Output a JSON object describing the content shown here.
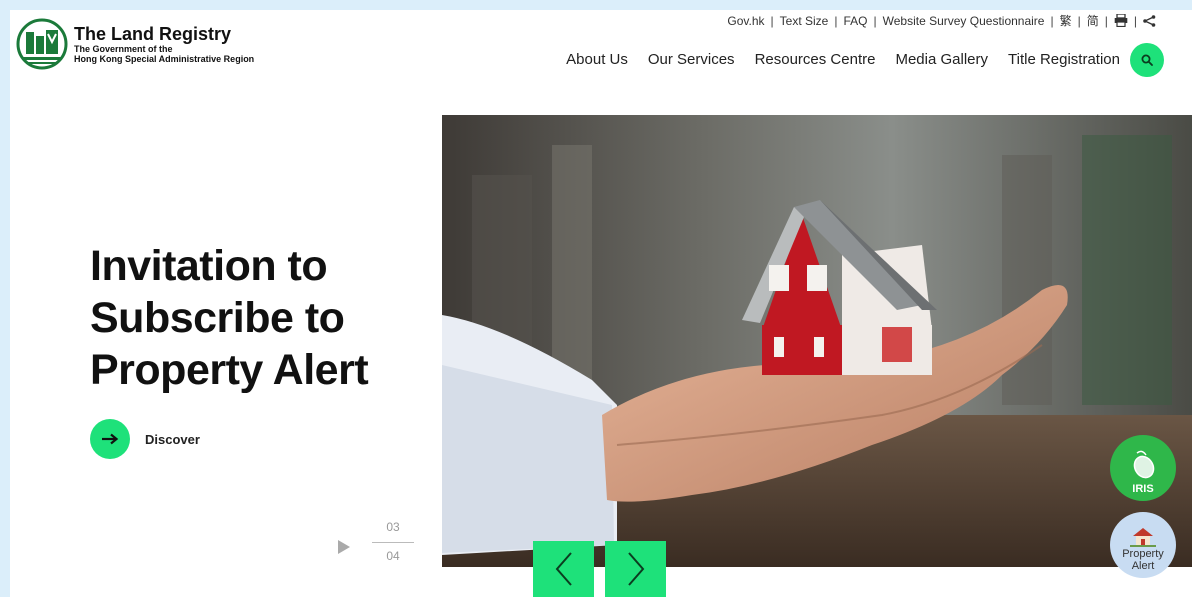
{
  "colors": {
    "accent_green": "#1ee17a",
    "highlight_orange": "#ff6b00",
    "iris_green": "#2fb74a",
    "page_bg": "#dbeefa"
  },
  "logo": {
    "title": "The Land Registry",
    "sub1": "The Government of the",
    "sub2": "Hong Kong Special Administrative Region"
  },
  "utility": {
    "govhk": "Gov.hk",
    "text_size": "Text Size",
    "faq": "FAQ",
    "survey": "Website Survey Questionnaire",
    "trad": "繁",
    "simp": "简",
    "sep": "|",
    "icons": [
      "print-icon",
      "share-icon"
    ]
  },
  "nav": {
    "items": [
      "About Us",
      "Our Services",
      "Resources Centre",
      "Media Gallery",
      "Title Registration"
    ],
    "search_icon": "search-icon"
  },
  "hero": {
    "line1": "Invitation to",
    "line2": "Subscribe to",
    "line3": "Property Alert",
    "discover_label": "Discover",
    "arrow_icon": "arrow-right-icon",
    "slide_current": "03",
    "slide_total": "04",
    "play_icon": "play-icon"
  },
  "carousel": {
    "prev_icon": "chevron-left-icon",
    "next_icon": "chevron-right-icon"
  },
  "floating": {
    "iris_label": "IRIS",
    "iris_icon": "mouse-icon",
    "alert_label1": "Property",
    "alert_label2": "Alert",
    "alert_icon": "house-icon"
  }
}
